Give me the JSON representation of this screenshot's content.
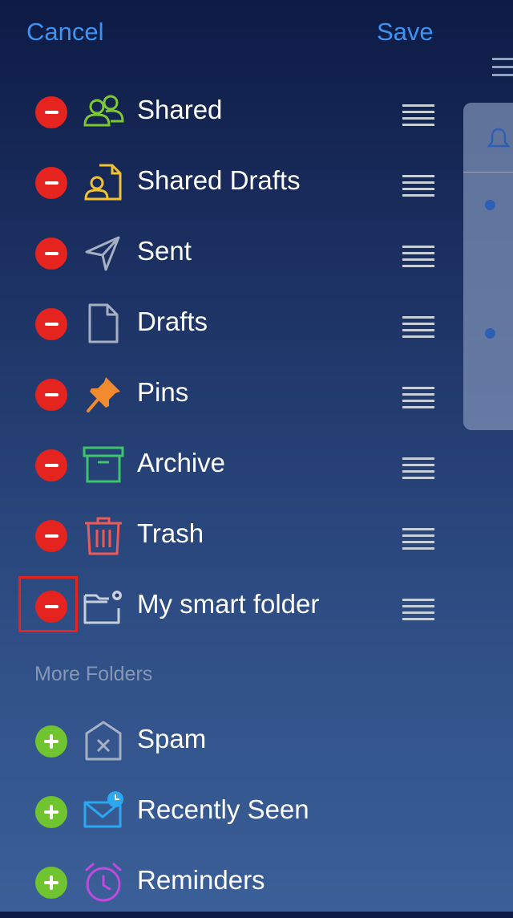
{
  "header": {
    "cancel_label": "Cancel",
    "save_label": "Save"
  },
  "folders": [
    {
      "label": "Shared",
      "icon": "shared-people-icon",
      "color": "#7cc832"
    },
    {
      "label": "Shared Drafts",
      "icon": "shared-drafts-icon",
      "color": "#f1c232"
    },
    {
      "label": "Sent",
      "icon": "paper-plane-icon",
      "color": "#a6b0c2"
    },
    {
      "label": "Drafts",
      "icon": "document-icon",
      "color": "#a6b0c2"
    },
    {
      "label": "Pins",
      "icon": "pin-icon",
      "color": "#f28a2e"
    },
    {
      "label": "Archive",
      "icon": "archive-box-icon",
      "color": "#3ec46d"
    },
    {
      "label": "Trash",
      "icon": "trash-icon",
      "color": "#ec5a5a"
    },
    {
      "label": "My smart folder",
      "icon": "smart-folder-icon",
      "color": "#c6cfdc"
    }
  ],
  "more_folders": {
    "title": "More Folders",
    "items": [
      {
        "label": "Spam",
        "icon": "spam-icon",
        "color": "#a6b0c2"
      },
      {
        "label": "Recently Seen",
        "icon": "recently-seen-icon",
        "color": "#2ba8f0"
      },
      {
        "label": "Reminders",
        "icon": "alarm-clock-icon",
        "color": "#c04ae0"
      }
    ]
  },
  "colors": {
    "accent": "#3d93f1",
    "remove": "#e52420",
    "add": "#6fc42f"
  }
}
